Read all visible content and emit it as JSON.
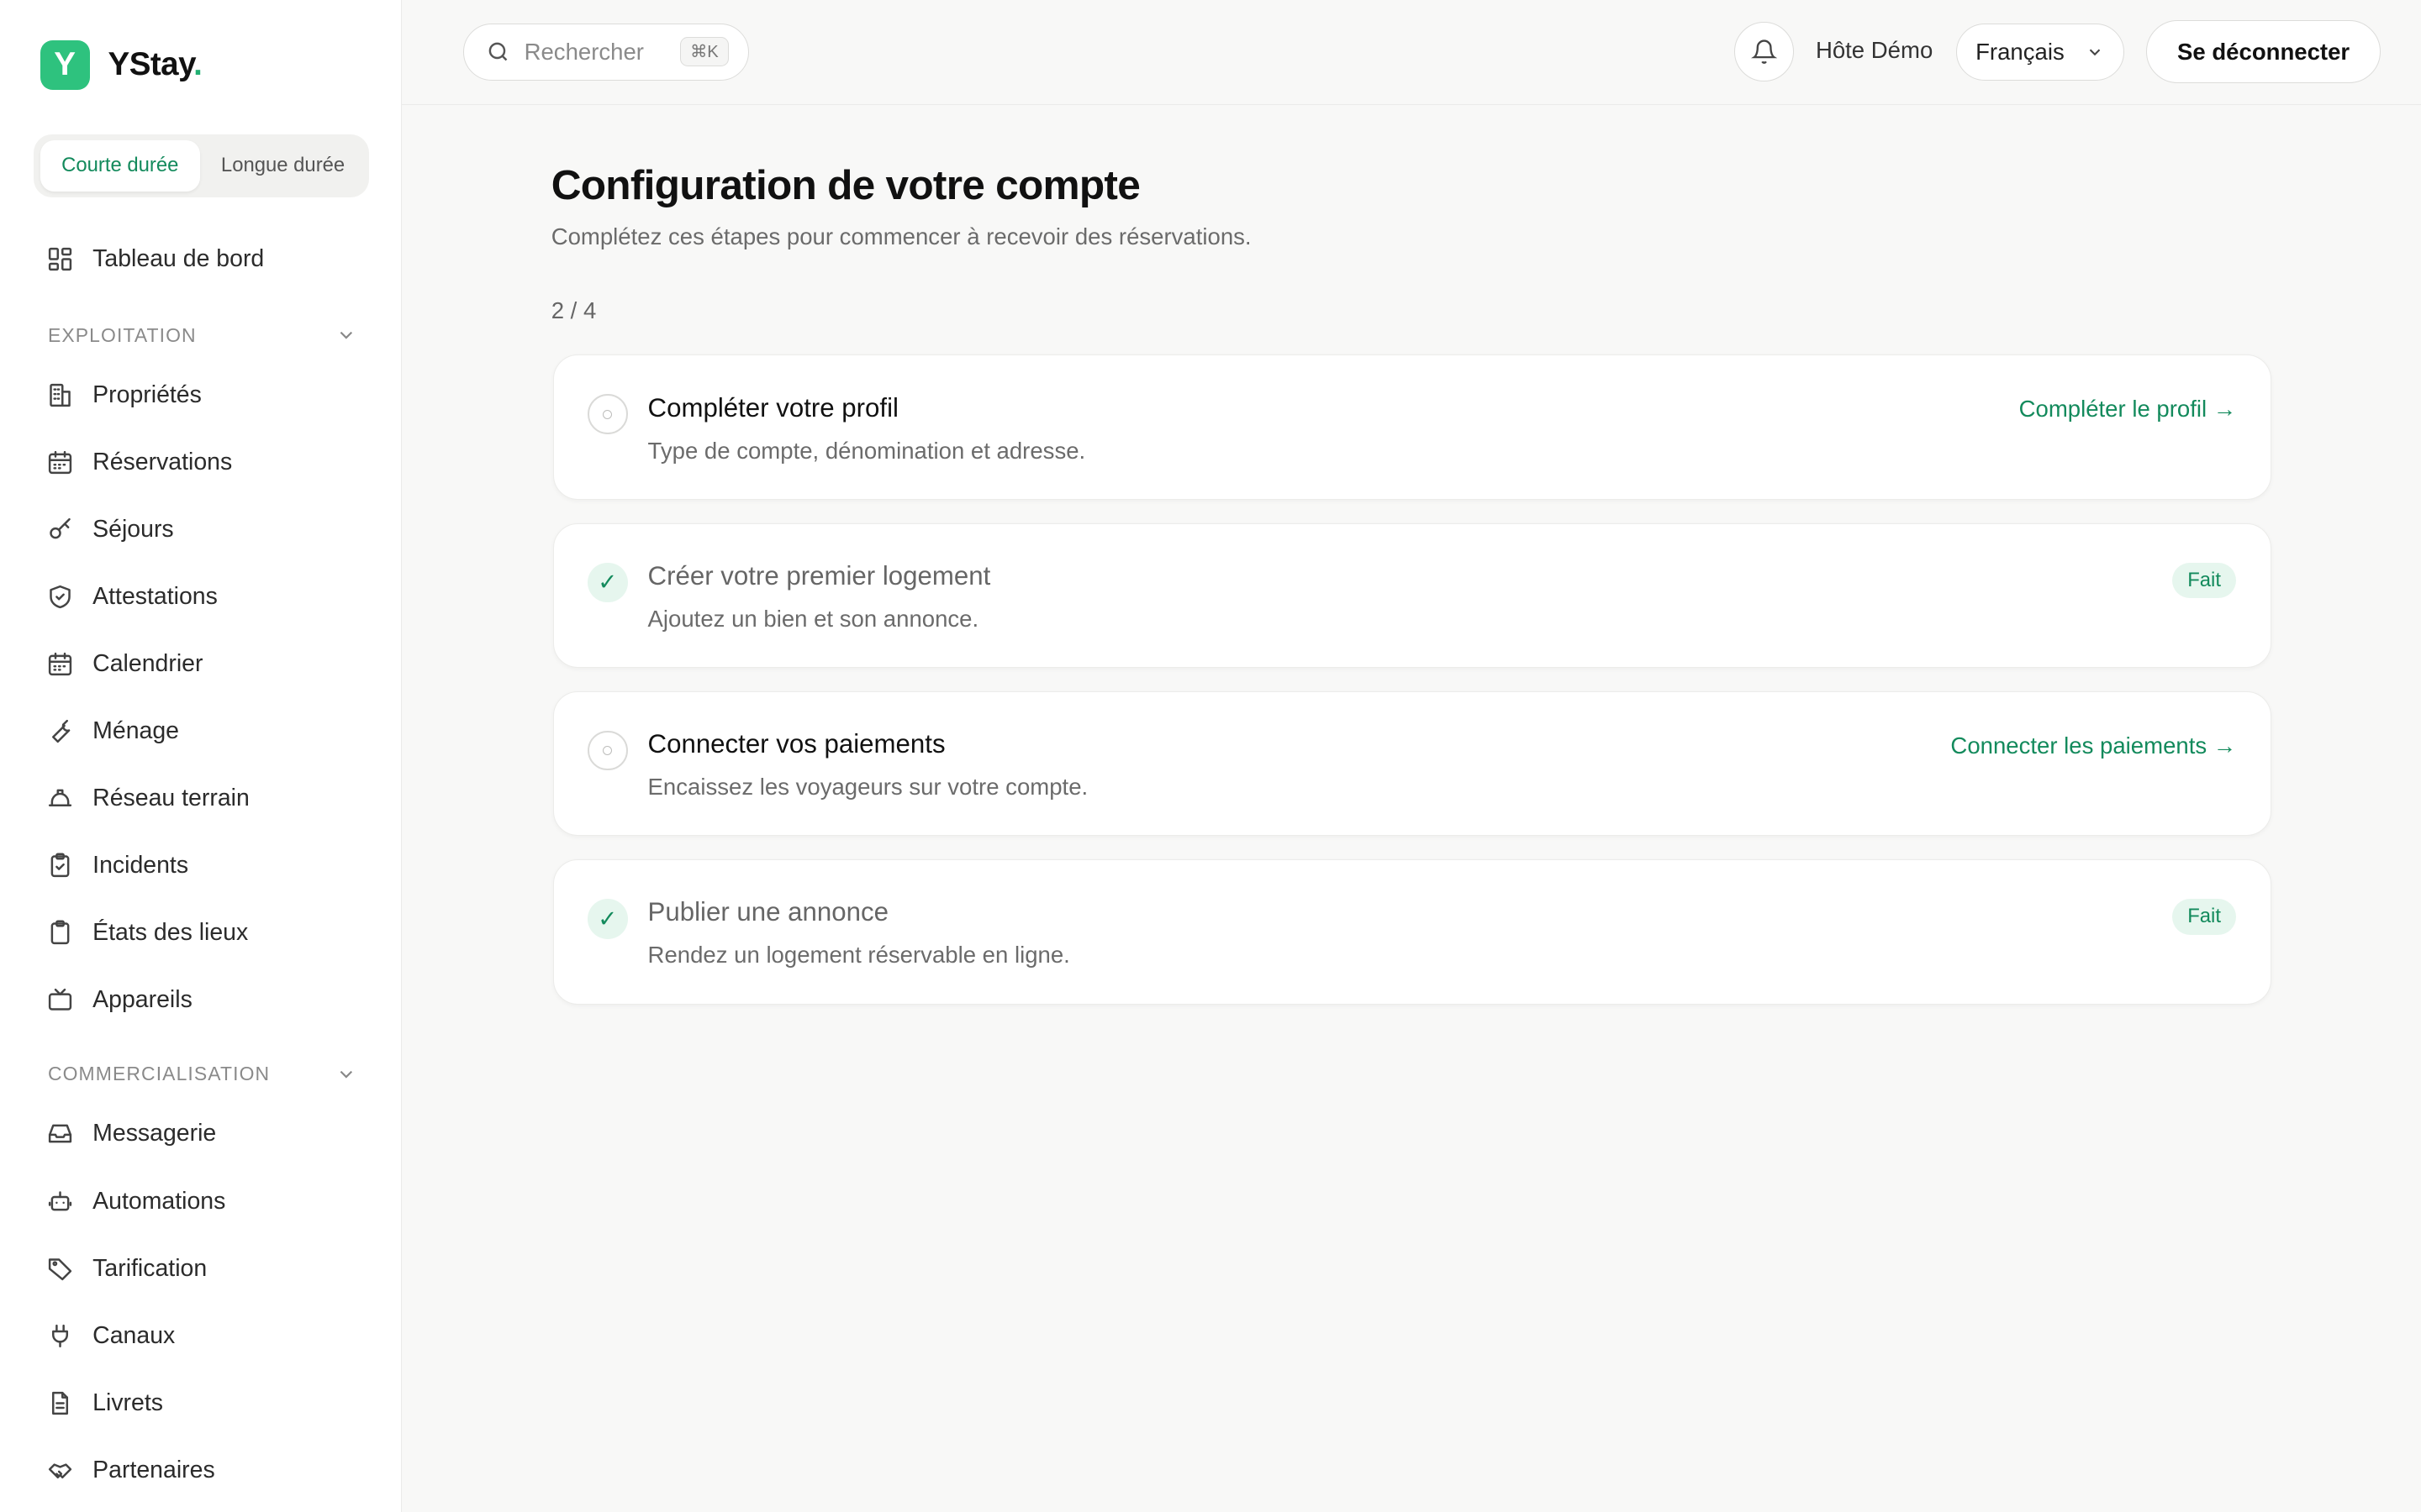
{
  "brand": {
    "name": "YStay",
    "dot": ".",
    "logo_letter": "Y",
    "accent": "#2ec27e"
  },
  "mode_toggle": {
    "short": "Courte durée",
    "long": "Longue durée",
    "selected": "Courte durée"
  },
  "sidebar": {
    "dashboard": {
      "label": "Tableau de bord",
      "icon": "dashboard-icon"
    },
    "section_exploitation": "EXPLOITATION",
    "exploitation_items": [
      {
        "label": "Propriétés",
        "icon": "building-icon"
      },
      {
        "label": "Réservations",
        "icon": "calendar-icon"
      },
      {
        "label": "Séjours",
        "icon": "key-icon"
      },
      {
        "label": "Attestations",
        "icon": "shield-icon"
      },
      {
        "label": "Calendrier",
        "icon": "calendar-icon"
      },
      {
        "label": "Ménage",
        "icon": "wrench-icon"
      },
      {
        "label": "Réseau terrain",
        "icon": "hardhat-icon"
      },
      {
        "label": "Incidents",
        "icon": "clipboard-check-icon"
      },
      {
        "label": "États des lieux",
        "icon": "clipboard-icon"
      },
      {
        "label": "Appareils",
        "icon": "tv-icon"
      }
    ],
    "section_commercialisation": "COMMERCIALISATION",
    "commercialisation_items": [
      {
        "label": "Messagerie",
        "icon": "inbox-icon"
      },
      {
        "label": "Automations",
        "icon": "bot-icon"
      },
      {
        "label": "Tarification",
        "icon": "tag-icon"
      },
      {
        "label": "Canaux",
        "icon": "plug-icon"
      },
      {
        "label": "Livrets",
        "icon": "file-icon"
      },
      {
        "label": "Partenaires",
        "icon": "handshake-icon"
      }
    ]
  },
  "topbar": {
    "search_placeholder": "Rechercher",
    "search_shortcut": "⌘K",
    "user_name": "Hôte Démo",
    "language": "Français",
    "logout": "Se déconnecter"
  },
  "page": {
    "title": "Configuration de votre compte",
    "subtitle": "Complétez ces étapes pour commencer à recevoir des réservations.",
    "progress": "2 / 4"
  },
  "steps": [
    {
      "title": "Compléter votre profil",
      "desc": "Type de compte, dénomination et adresse.",
      "done": false,
      "action": "Compléter le profil →"
    },
    {
      "title": "Créer votre premier logement",
      "desc": "Ajoutez un bien et son annonce.",
      "done": true,
      "badge": "Fait"
    },
    {
      "title": "Connecter vos paiements",
      "desc": "Encaissez les voyageurs sur votre compte.",
      "done": false,
      "action": "Connecter les paiements →"
    },
    {
      "title": "Publier une annonce",
      "desc": "Rendez un logement réservable en ligne.",
      "done": true,
      "badge": "Fait"
    }
  ]
}
